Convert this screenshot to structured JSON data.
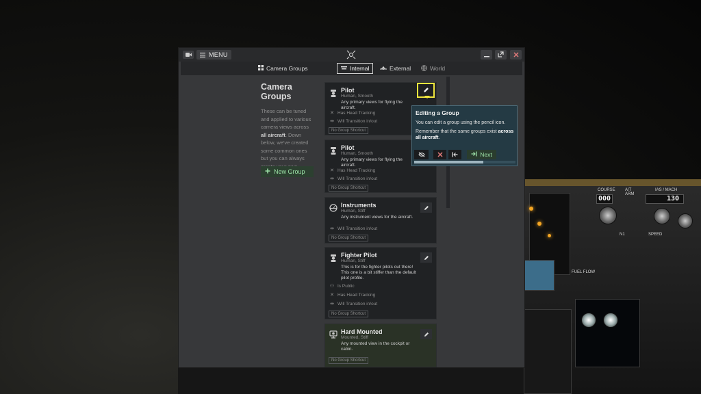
{
  "window": {
    "menu_label": "MENU",
    "icons": {
      "camera": "video-camera-icon",
      "menu": "hamburger-icon",
      "logo": "camera-drone-icon",
      "minimize": "minimize-icon",
      "popout": "popout-icon",
      "close": "close-icon"
    }
  },
  "tabs": {
    "camera_groups": "Camera Groups",
    "internal": "Internal",
    "external": "External",
    "world": "World"
  },
  "sidebar": {
    "title": "Camera Groups",
    "desc_1": "These can be tuned and applied to various camera views across ",
    "desc_bold": "all aircraft",
    "desc_2": ". Down below, we've created some common ones but you can always create your own.",
    "new_group": "New Group"
  },
  "cards": [
    {
      "title": "Pilot",
      "subtitle": "Human, Smooth",
      "desc": "Any primary views for flying the aircraft.",
      "features": [
        "Has Head Tracking",
        "Will Transition in/out"
      ],
      "shortcut": "No Group Shortcut"
    },
    {
      "title": "Pilot",
      "subtitle": "Human, Smooth",
      "desc": "Any primary views for flying the aircraft.",
      "features": [
        "Has Head Tracking",
        "Will Transition in/out"
      ],
      "shortcut": "No Group Shortcut"
    },
    {
      "title": "Instruments",
      "subtitle": "Human, Stiff",
      "desc": "Any instrument views for the aircraft.",
      "features": [
        "Will Transition in/out"
      ],
      "shortcut": "No Group Shortcut"
    },
    {
      "title": "Fighter Pilot",
      "subtitle": "Human, Stiff",
      "desc": "This is for the fighter pilots out there! This one is a bit stiffer than the default pilot profile.",
      "features": [
        "Is Public",
        "Has Head Tracking",
        "Will Transition in/out"
      ],
      "shortcut": "No Group Shortcut"
    },
    {
      "title": "Hard Mounted",
      "subtitle": "Mounted, Stiff",
      "desc": "Any mounted view in the cockpit or cabin.",
      "features": [],
      "shortcut": "No Group Shortcut"
    }
  ],
  "tooltip": {
    "title": "Editing a Group",
    "line1": "You can edit a group using the pencil icon.",
    "line2": "Remember that the same groups exist ",
    "line2_bold": "across all aircraft",
    "line2_end": ".",
    "next": "Next",
    "progress": 0.68
  },
  "cockpit": {
    "course": "COURSE",
    "course_val": "000",
    "at_arm": "A/T ARM",
    "ias_mach": "IAS / MACH",
    "speed_val": "130",
    "fuel_flow": "FUEL FLOW",
    "n1": "N1",
    "speed": "SPEED"
  },
  "colors": {
    "accent_green": "#9be0a6",
    "highlight_yellow": "#f0e63d",
    "tooltip_bg": "#243a44"
  }
}
